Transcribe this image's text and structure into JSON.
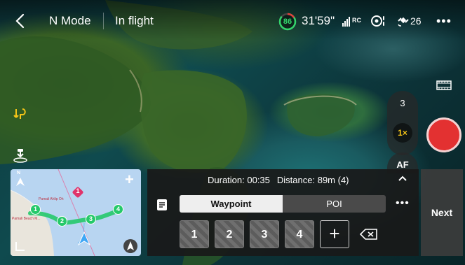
{
  "topbar": {
    "mode": "N Mode",
    "flight_status": "In flight",
    "battery_percent": "86",
    "flight_time": "31'59\"",
    "rc_label": "RC",
    "gps_count": "26",
    "more_label": "•••"
  },
  "camera": {
    "zoom_options": [
      "3",
      "1×"
    ],
    "active_zoom": "1×",
    "af_label": "AF"
  },
  "minimap": {
    "north_label": "N",
    "poi_marker": "1",
    "waypoints": [
      "1",
      "2",
      "3",
      "4"
    ],
    "place_labels": [
      "Pamali Ahlip Oh",
      "Pamali Beach M..."
    ],
    "add_label": "+"
  },
  "waypoint_panel": {
    "duration": "Duration: 00:35",
    "distance": "Distance: 89m (4)",
    "tabs": [
      "Waypoint",
      "POI"
    ],
    "active_tab": "Waypoint",
    "more_label": "•••",
    "buttons": [
      "1",
      "2",
      "3",
      "4"
    ],
    "add_label": "+"
  },
  "next_label": "Next",
  "colors": {
    "record": "#e33131",
    "battery": "#33d46b",
    "zoom_active": "#f5c518",
    "route": "#2bd46b"
  }
}
